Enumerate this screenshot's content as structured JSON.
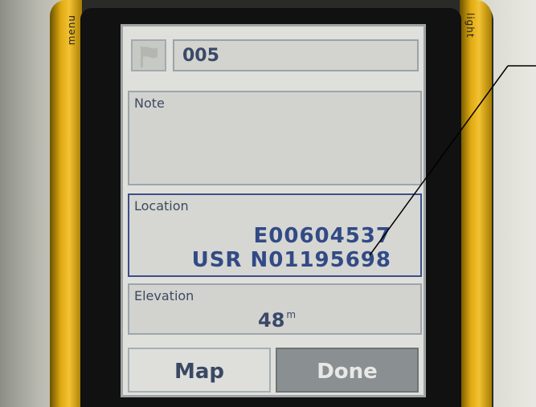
{
  "device": {
    "side_label_left": "menu",
    "side_label_right": "light"
  },
  "waypoint": {
    "name": "005",
    "flag_icon": "flag-icon"
  },
  "note": {
    "label": "Note",
    "value": ""
  },
  "location": {
    "label": "Location",
    "line1": "E00604537",
    "line2": "USR N01195698"
  },
  "elevation": {
    "label": "Elevation",
    "value": "48",
    "unit": "m"
  },
  "buttons": {
    "map_label": "Map",
    "done_label": "Done"
  }
}
